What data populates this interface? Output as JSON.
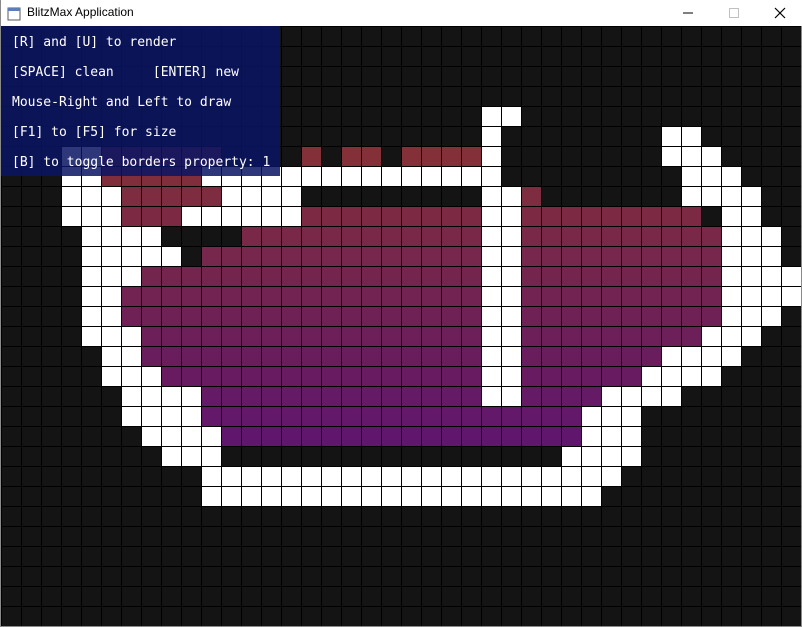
{
  "window": {
    "title": "BlitzMax Application",
    "controls": [
      "minimize",
      "maximize",
      "close"
    ]
  },
  "help": {
    "lines": [
      "[R] and [U] to render",
      "[SPACE] clean     [ENTER] new",
      "Mouse-Right and Left to draw",
      "[F1] to [F5] for size",
      "[B] to toggle borders property: 1"
    ]
  },
  "grid": {
    "columns": 40,
    "rows": 30,
    "borders": true,
    "background_color": "#141414",
    "gridline_color": "#000000",
    "wall_color": "#ffffff",
    "fill_color_top": "#833038",
    "fill_color_bottom": "#5e1470",
    "white_rows": [
      [],
      [],
      [],
      [],
      [
        [
          24,
          25
        ]
      ],
      [
        [
          24,
          24
        ],
        [
          33,
          34
        ]
      ],
      [
        [
          3,
          4
        ],
        [
          24,
          24
        ],
        [
          33,
          35
        ]
      ],
      [
        [
          3,
          4
        ],
        [
          10,
          24
        ],
        [
          34,
          36
        ]
      ],
      [
        [
          3,
          5
        ],
        [
          11,
          14
        ],
        [
          24,
          25
        ],
        [
          34,
          37
        ]
      ],
      [
        [
          3,
          5
        ],
        [
          9,
          14
        ],
        [
          24,
          25
        ],
        [
          36,
          37
        ]
      ],
      [
        [
          4,
          7
        ],
        [
          24,
          25
        ],
        [
          36,
          38
        ]
      ],
      [
        [
          4,
          8
        ],
        [
          24,
          25
        ],
        [
          36,
          38
        ]
      ],
      [
        [
          4,
          6
        ],
        [
          24,
          25
        ],
        [
          36,
          39
        ]
      ],
      [
        [
          4,
          5
        ],
        [
          24,
          25
        ],
        [
          36,
          39
        ]
      ],
      [
        [
          4,
          5
        ],
        [
          24,
          25
        ],
        [
          36,
          38
        ]
      ],
      [
        [
          4,
          6
        ],
        [
          24,
          25
        ],
        [
          35,
          37
        ]
      ],
      [
        [
          5,
          6
        ],
        [
          24,
          25
        ],
        [
          33,
          36
        ]
      ],
      [
        [
          5,
          7
        ],
        [
          24,
          25
        ],
        [
          32,
          35
        ]
      ],
      [
        [
          6,
          9
        ],
        [
          24,
          25
        ],
        [
          30,
          33
        ]
      ],
      [
        [
          6,
          9
        ],
        [
          29,
          31
        ]
      ],
      [
        [
          7,
          10
        ],
        [
          29,
          31
        ]
      ],
      [
        [
          8,
          10
        ],
        [
          28,
          31
        ]
      ],
      [
        [
          10,
          30
        ]
      ],
      [
        [
          10,
          29
        ]
      ],
      [],
      [],
      [],
      [],
      [],
      []
    ],
    "fill_rows": [
      [],
      [],
      [],
      [],
      [],
      [],
      [
        [
          5,
          10
        ],
        [
          15,
          15
        ],
        [
          17,
          18
        ],
        [
          20,
          23
        ]
      ],
      [
        [
          5,
          9
        ]
      ],
      [
        [
          6,
          10
        ],
        [
          26,
          26
        ]
      ],
      [
        [
          6,
          8
        ],
        [
          15,
          23
        ],
        [
          26,
          34
        ]
      ],
      [
        [
          12,
          23
        ],
        [
          26,
          35
        ]
      ],
      [
        [
          10,
          23
        ],
        [
          26,
          35
        ]
      ],
      [
        [
          7,
          23
        ],
        [
          26,
          35
        ]
      ],
      [
        [
          6,
          23
        ],
        [
          26,
          35
        ]
      ],
      [
        [
          6,
          23
        ],
        [
          26,
          35
        ]
      ],
      [
        [
          7,
          23
        ],
        [
          26,
          34
        ]
      ],
      [
        [
          7,
          23
        ],
        [
          26,
          32
        ]
      ],
      [
        [
          8,
          23
        ],
        [
          26,
          31
        ]
      ],
      [
        [
          10,
          23
        ],
        [
          26,
          29
        ]
      ],
      [
        [
          10,
          28
        ]
      ],
      [
        [
          11,
          28
        ]
      ],
      [],
      [],
      [],
      [],
      [],
      [],
      [],
      [],
      []
    ]
  }
}
